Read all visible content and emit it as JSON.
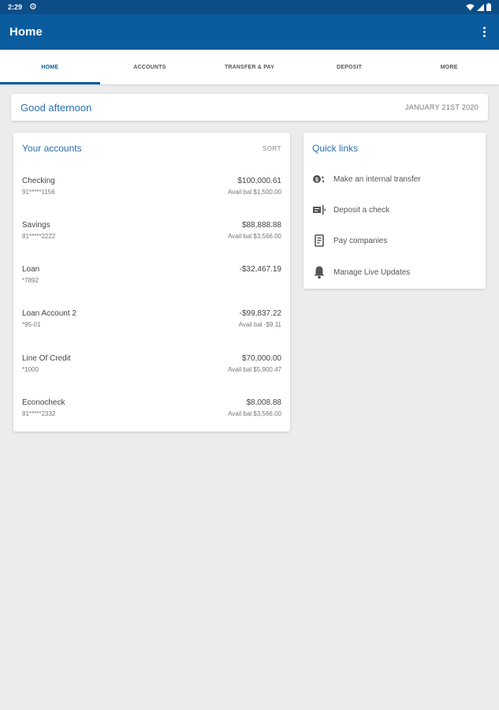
{
  "status_bar": {
    "time": "2:29"
  },
  "app_bar": {
    "title": "Home"
  },
  "tabs": [
    {
      "label": "HOME",
      "active": true
    },
    {
      "label": "ACCOUNTS",
      "active": false
    },
    {
      "label": "TRANSFER & PAY",
      "active": false
    },
    {
      "label": "DEPOSIT",
      "active": false
    },
    {
      "label": "MORE",
      "active": false
    }
  ],
  "greeting": {
    "text": "Good afternoon",
    "date": "JANUARY 21ST 2020"
  },
  "accounts": {
    "title": "Your accounts",
    "sort_label": "SORT",
    "items": [
      {
        "name": "Checking",
        "number": "91*****1156",
        "balance": "$100,000.61",
        "avail": "Avail bal $1,500.00"
      },
      {
        "name": "Savings",
        "number": "81*****2222",
        "balance": "$88,888.88",
        "avail": "Avail bal $3,566.00"
      },
      {
        "name": "Loan",
        "number": "*7892",
        "balance": "-$32,467.19",
        "avail": ""
      },
      {
        "name": "Loan Account 2",
        "number": "*95-01",
        "balance": "-$99,837.22",
        "avail": "Avail bal -$9.11"
      },
      {
        "name": "Line Of Credit",
        "number": "*1000",
        "balance": "$70,000.00",
        "avail": "Avail bal $5,900.47"
      },
      {
        "name": "Econocheck",
        "number": "81*****2332",
        "balance": "$8,008.88",
        "avail": "Avail bal $3,566.00"
      }
    ]
  },
  "quick_links": {
    "title": "Quick links",
    "items": [
      {
        "label": "Make an internal transfer",
        "icon": "transfer-icon"
      },
      {
        "label": "Deposit a check",
        "icon": "check-deposit-icon"
      },
      {
        "label": "Pay companies",
        "icon": "bill-pay-icon"
      },
      {
        "label": "Manage Live Updates",
        "icon": "bell-icon"
      }
    ]
  },
  "colors": {
    "status_bar": "#0c4d88",
    "app_bar": "#0a5c9e",
    "accent": "#2a6fac",
    "background": "#ececec"
  }
}
